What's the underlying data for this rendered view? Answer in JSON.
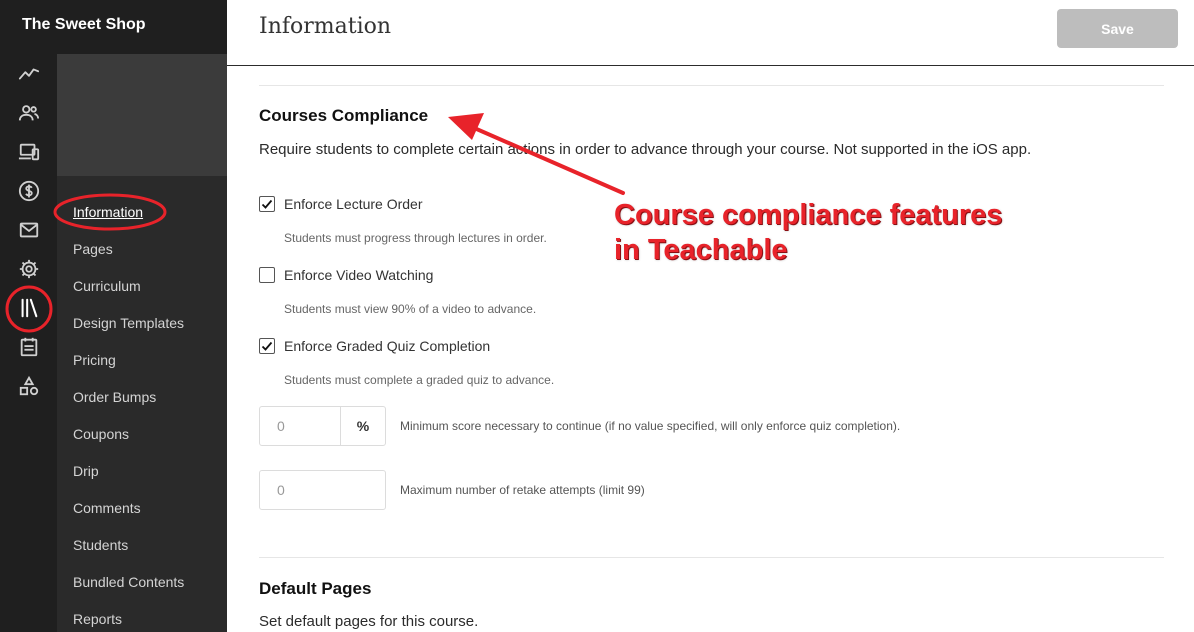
{
  "app": {
    "school_name": "The Sweet Shop"
  },
  "rail_icons": [
    "analytics-icon",
    "users-icon",
    "devices-icon",
    "dollar-icon",
    "mail-icon",
    "settings-icon",
    "library-icon",
    "calendar-icon",
    "shapes-icon"
  ],
  "subnav": {
    "items": [
      {
        "label": "Information",
        "active": true
      },
      {
        "label": "Pages"
      },
      {
        "label": "Curriculum"
      },
      {
        "label": "Design Templates"
      },
      {
        "label": "Pricing"
      },
      {
        "label": "Order Bumps"
      },
      {
        "label": "Coupons"
      },
      {
        "label": "Drip"
      },
      {
        "label": "Comments"
      },
      {
        "label": "Students"
      },
      {
        "label": "Bundled Contents"
      },
      {
        "label": "Reports"
      }
    ]
  },
  "header": {
    "title": "Information",
    "save_label": "Save"
  },
  "compliance": {
    "title": "Courses Compliance",
    "description": "Require students to complete certain actions in order to advance through your course. Not supported in the iOS app.",
    "options": [
      {
        "label": "Enforce Lecture Order",
        "help": "Students must progress through lectures in order.",
        "checked": true
      },
      {
        "label": "Enforce Video Watching",
        "help": "Students must view 90% of a video to advance.",
        "checked": false
      },
      {
        "label": "Enforce Graded Quiz Completion",
        "help": "Students must complete a graded quiz to advance.",
        "checked": true
      }
    ],
    "min_score": {
      "placeholder": "0",
      "addon": "%",
      "help": "Minimum score necessary to continue (if no value specified, will only enforce quiz completion)."
    },
    "retakes": {
      "placeholder": "0",
      "help": "Maximum number of retake attempts (limit 99)"
    }
  },
  "default_pages": {
    "title": "Default Pages",
    "description": "Set default pages for this course."
  },
  "annotation": {
    "line1": "Course compliance features",
    "line2": "in Teachable",
    "color": "#e8232a"
  }
}
